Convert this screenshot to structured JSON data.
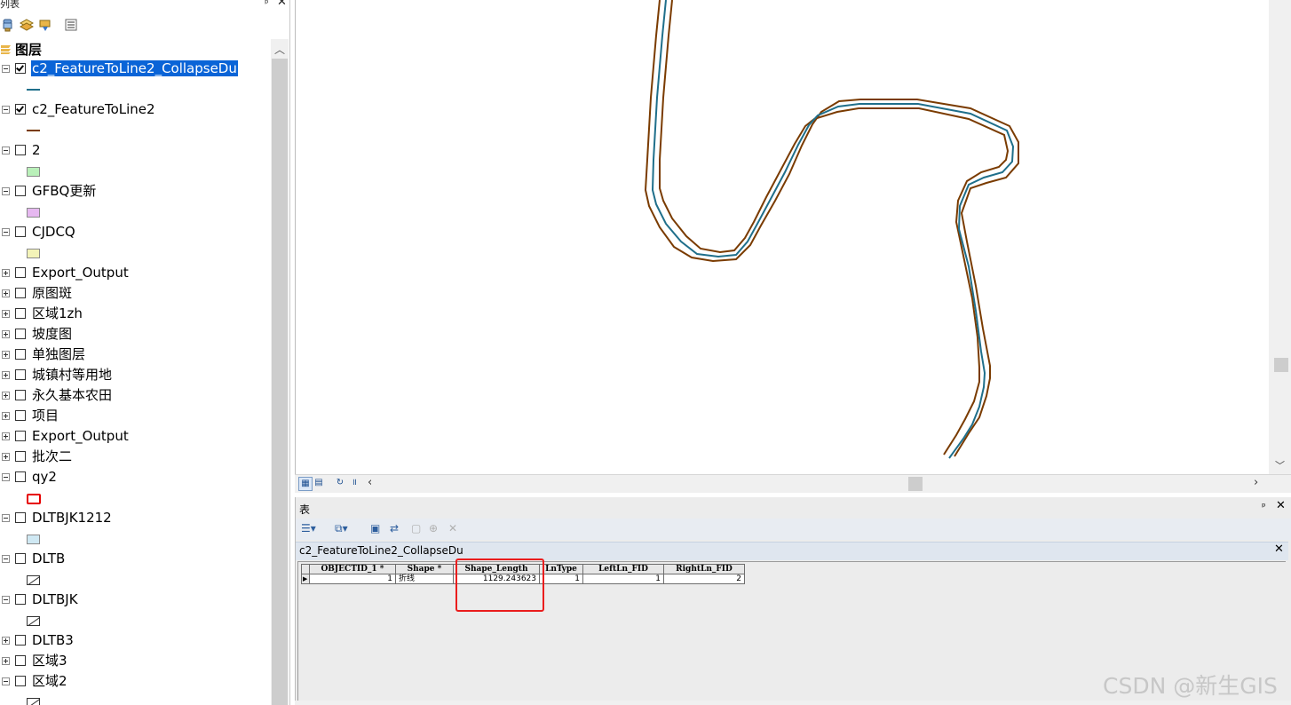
{
  "toc": {
    "title": "列表",
    "pin": "ᵖ",
    "close": "✕",
    "group_label": "图层",
    "layers": [
      {
        "label": "c2_FeatureToLine2_CollapseDu",
        "checked": true,
        "selected": true,
        "expanded": true,
        "symbol": "line",
        "symbol_color": "#1f6f8b"
      },
      {
        "label": "c2_FeatureToLine2",
        "checked": true,
        "expanded": true,
        "symbol": "line",
        "symbol_color": "#7a3b00"
      },
      {
        "label": "2",
        "checked": false,
        "expanded": true,
        "symbol": "fill",
        "symbol_color": "#b9f0b9"
      },
      {
        "label": "GFBQ更新",
        "checked": false,
        "expanded": true,
        "symbol": "fill",
        "symbol_color": "#e6b8f0"
      },
      {
        "label": "CJDCQ",
        "checked": false,
        "expanded": true,
        "symbol": "fill",
        "symbol_color": "#f3f3b8"
      },
      {
        "label": "Export_Output",
        "checked": false,
        "expanded": false
      },
      {
        "label": "原图斑",
        "checked": false,
        "expanded": false
      },
      {
        "label": "区域1zh",
        "checked": false,
        "expanded": false
      },
      {
        "label": "坡度图",
        "checked": false,
        "expanded": false
      },
      {
        "label": "单独图层",
        "checked": false,
        "expanded": false
      },
      {
        "label": "城镇村等用地",
        "checked": false,
        "expanded": false
      },
      {
        "label": "永久基本农田",
        "checked": false,
        "expanded": false
      },
      {
        "label": "项目",
        "checked": false,
        "expanded": false
      },
      {
        "label": "Export_Output",
        "checked": false,
        "expanded": false
      },
      {
        "label": "批次二",
        "checked": false,
        "expanded": false
      },
      {
        "label": "qy2",
        "checked": false,
        "expanded": true,
        "symbol": "red-outline",
        "symbol_color": "#e60000"
      },
      {
        "label": "DLTBJK1212",
        "checked": false,
        "expanded": true,
        "symbol": "fill",
        "symbol_color": "#cfe8f3"
      },
      {
        "label": "DLTB",
        "checked": false,
        "expanded": true,
        "symbol": "hatch"
      },
      {
        "label": "DLTBJK",
        "checked": false,
        "expanded": true,
        "symbol": "hatch"
      },
      {
        "label": "DLTB3",
        "checked": false,
        "expanded": false
      },
      {
        "label": "区域3",
        "checked": false,
        "expanded": false
      },
      {
        "label": "区域2",
        "checked": false,
        "expanded": true,
        "symbol": "hatch"
      }
    ]
  },
  "map": {
    "line_colors": {
      "outer": "#7a3b00",
      "center": "#1f6f8b"
    }
  },
  "table_panel": {
    "title": "表",
    "table_name": "c2_FeatureToLine2_CollapseDu",
    "columns": [
      "OBJECTID_1 *",
      "Shape *",
      "Shape_Length",
      "LnType",
      "LeftLn_FID",
      "RightLn_FID"
    ],
    "rows": [
      [
        "1",
        "折线",
        "1129.243623",
        "1",
        "1",
        "2"
      ]
    ],
    "highlight_color": "#ea1d1d"
  },
  "watermark": "CSDN @新生GIS"
}
